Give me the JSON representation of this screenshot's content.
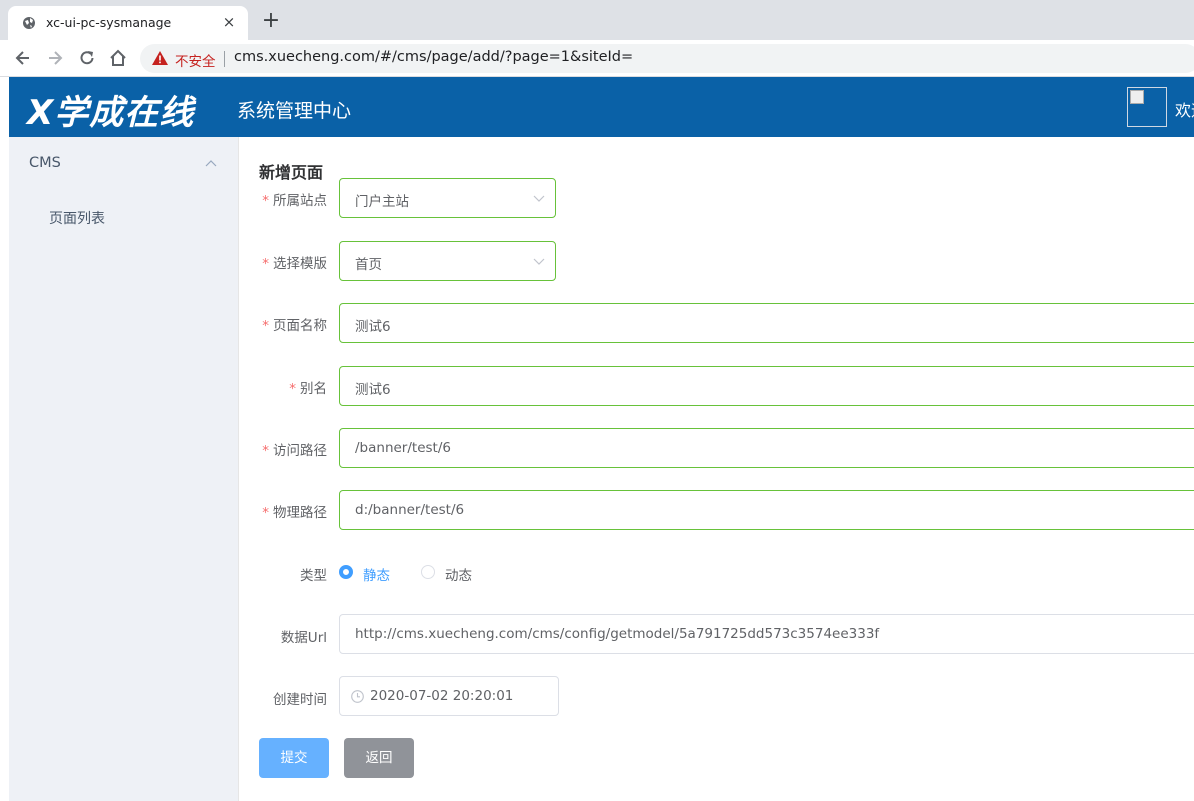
{
  "browser": {
    "tab_title": "xc-ui-pc-sysmanage",
    "tab_close": "×",
    "new_tab": "+",
    "insecure_label": "不安全",
    "url": "cms.xuecheng.com/#/cms/page/add/?page=1&siteId="
  },
  "header": {
    "logo_text": "X学成在线",
    "subtitle": "系统管理中心",
    "welcome": "欢迎"
  },
  "sidebar": {
    "menu_title": "CMS",
    "items": [
      {
        "label": "页面列表"
      }
    ]
  },
  "form": {
    "title": "新增页面",
    "site": {
      "label": "所属站点",
      "value": "门户主站"
    },
    "template": {
      "label": "选择模版",
      "value": "首页"
    },
    "page_name": {
      "label": "页面名称",
      "value": "测试6"
    },
    "alias": {
      "label": "别名",
      "value": "测试6"
    },
    "web_path": {
      "label": "访问路径",
      "value": "/banner/test/6"
    },
    "physical_path": {
      "label": "物理路径",
      "value": "d:/banner/test/6"
    },
    "type": {
      "label": "类型",
      "options": [
        "静态",
        "动态"
      ],
      "selected": "静态"
    },
    "data_url": {
      "label": "数据Url",
      "value": "http://cms.xuecheng.com/cms/config/getmodel/5a791725dd573c3574ee333f"
    },
    "create_time": {
      "label": "创建时间",
      "value": "2020-07-02 20:20:01"
    },
    "required_mark": "*",
    "submit_label": "提交",
    "back_label": "返回"
  },
  "icons": [
    "globe-icon",
    "back-arrow-icon",
    "forward-arrow-icon",
    "reload-icon",
    "home-icon",
    "warning-icon",
    "chevron-up-icon",
    "chevron-down-icon",
    "clock-icon"
  ],
  "colors": {
    "header_bg": "#0a61a7",
    "sidebar_bg": "#eef1f6",
    "valid_border": "#67c23a",
    "primary": "#409eff",
    "primary_disabled": "#66b1ff",
    "info": "#909399",
    "danger": "#f56c6c"
  }
}
